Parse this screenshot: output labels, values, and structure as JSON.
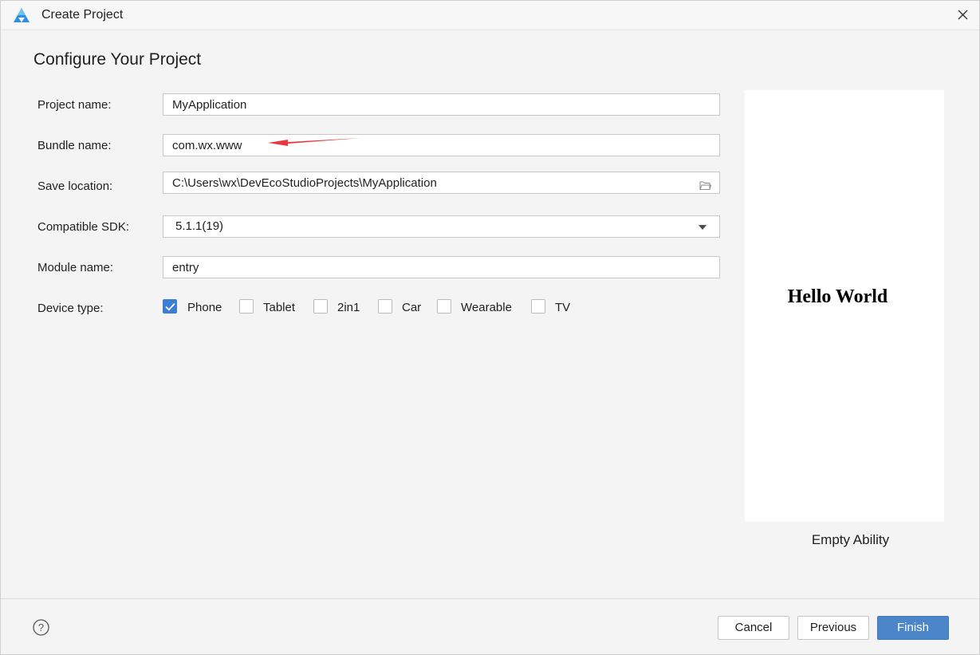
{
  "window": {
    "title": "Create Project",
    "app_icon": "deveco-logo-icon",
    "close_icon": "close-icon"
  },
  "heading": "Configure Your Project",
  "form": {
    "project_name": {
      "label": "Project name:",
      "value": "MyApplication"
    },
    "bundle_name": {
      "label": "Bundle name:",
      "value": "com.wx.www"
    },
    "save_location": {
      "label": "Save location:",
      "value": "C:\\Users\\wx\\DevEcoStudioProjects\\MyApplication",
      "icon": "folder-icon"
    },
    "compatible_sdk": {
      "label": "Compatible SDK:",
      "value": "5.1.1(19)",
      "icon": "chevron-down-icon"
    },
    "module_name": {
      "label": "Module name:",
      "value": "entry"
    },
    "device_type": {
      "label": "Device type:",
      "options": [
        {
          "label": "Phone",
          "checked": true
        },
        {
          "label": "Tablet",
          "checked": false
        },
        {
          "label": "2in1",
          "checked": false
        },
        {
          "label": "Car",
          "checked": false
        },
        {
          "label": "Wearable",
          "checked": false
        },
        {
          "label": "TV",
          "checked": false
        }
      ]
    }
  },
  "preview": {
    "text": "Hello World",
    "template_name": "Empty Ability"
  },
  "footer": {
    "help_icon": "help-icon",
    "cancel_label": "Cancel",
    "previous_label": "Previous",
    "finish_label": "Finish"
  },
  "colors": {
    "accent": "#3b7fd4",
    "primary_button": "#4a86c8",
    "annotation_arrow": "#e8383d",
    "background": "#f4f4f4"
  }
}
